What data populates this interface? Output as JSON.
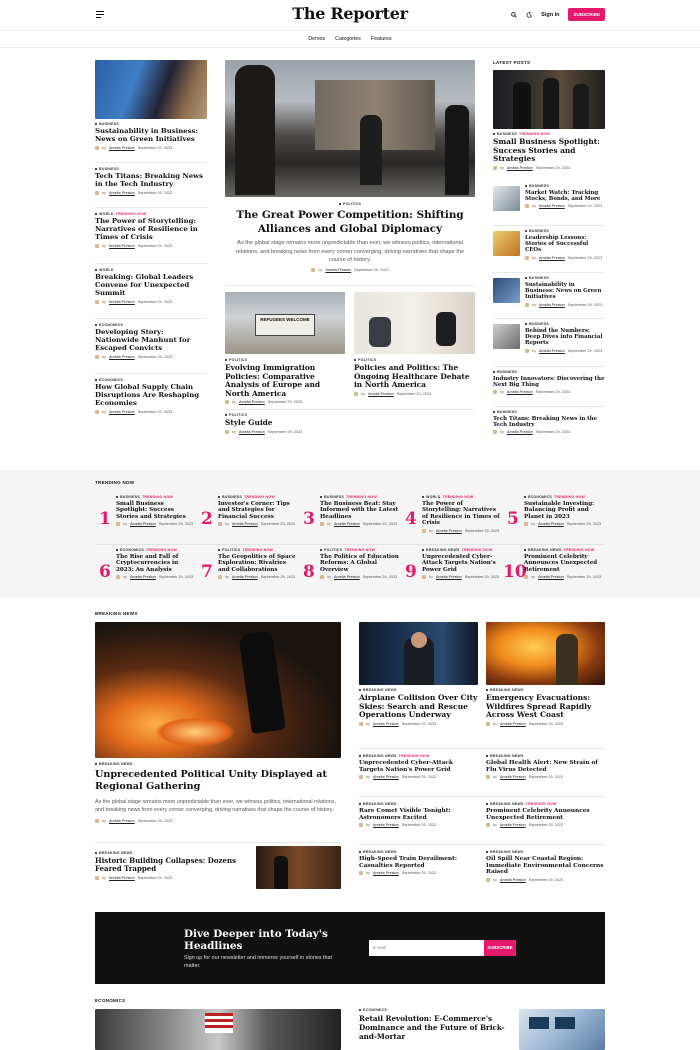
{
  "header": {
    "logo": "The Reporter",
    "sign_in": "Sign in",
    "subscribe": "SUBSCRIBE",
    "nav": [
      "Demos",
      "Categories",
      "Features"
    ]
  },
  "byline": {
    "by": "by",
    "author": "Amelia Preston",
    "date": "September 29, 2023"
  },
  "left_column": [
    {
      "kicker": "BUSINESS",
      "hot": "",
      "title": "Sustainability in Business: News on Green Initiatives"
    },
    {
      "kicker": "BUSINESS",
      "hot": "",
      "title": "Tech Titans: Breaking News in the Tech Industry"
    },
    {
      "kicker": "WORLD",
      "hot": "TRENDING NOW",
      "title": "The Power of Storytelling: Narratives of Resilience in Times of Crisis"
    },
    {
      "kicker": "WORLD",
      "hot": "",
      "title": "Breaking: Global Leaders Convene for Unexpected Summit"
    },
    {
      "kicker": "ECONOMICS",
      "hot": "",
      "title": "Developing Story: Nationwide Manhunt for Escaped Convicts"
    },
    {
      "kicker": "ECONOMICS",
      "hot": "",
      "title": "How Global Supply Chain Disruptions Are Reshaping Economies"
    }
  ],
  "feature": {
    "kicker": "POLITICS",
    "title": "The Great Power Competition: Shifting Alliances and Global Diplomacy",
    "excerpt": "As the global stage remains more unpredictable than ever, we witness politics, international relations, and breaking news from every corner converging, driving narratives that shape the course of history."
  },
  "sub_features": [
    {
      "kicker": "POLITICS",
      "title": "Evolving Immigration Policies: Comparative Analysis of Europe and North America",
      "sign": "REFUGEES WELCOME"
    },
    {
      "kicker": "POLITICS",
      "title": "Policies and Politics: The Ongoing Healthcare Debate in North America"
    }
  ],
  "style_guide": {
    "kicker": "POLITICS",
    "title": "Style Guide"
  },
  "latest": {
    "label": "LATEST POSTS",
    "top": {
      "kicker": "BUSINESS",
      "hot": "TRENDING NOW",
      "title": "Small Business Spotlight: Success Stories and Strategies"
    },
    "items": [
      {
        "kicker": "BUSINESS",
        "title": "Market Watch: Tracking Stocks, Bonds, and More"
      },
      {
        "kicker": "BUSINESS",
        "title": "Leadership Lessons: Stories of Successful CEOs"
      },
      {
        "kicker": "BUSINESS",
        "title": "Sustainability in Business: News on Green Initiatives"
      },
      {
        "kicker": "BUSINESS",
        "title": "Behind the Numbers: Deep Dives into Financial Reports"
      },
      {
        "kicker": "BUSINESS",
        "title": "Industry Innovators: Discovering the Next Big Thing"
      },
      {
        "kicker": "BUSINESS",
        "title": "Tech Titans: Breaking News in the Tech Industry"
      }
    ]
  },
  "trending": {
    "label": "TRENDING NOW",
    "items": [
      {
        "num": "1",
        "kicker": "BUSINESS",
        "title": "Small Business Spotlight: Success Stories and Strategies"
      },
      {
        "num": "2",
        "kicker": "BUSINESS",
        "title": "Investor's Corner: Tips and Strategies for Financial Success"
      },
      {
        "num": "3",
        "kicker": "BUSINESS",
        "title": "The Business Beat: Stay Informed with the Latest Headlines"
      },
      {
        "num": "4",
        "kicker": "WORLD",
        "title": "The Power of Storytelling: Narratives of Resilience in Times of Crisis"
      },
      {
        "num": "5",
        "kicker": "ECONOMICS",
        "title": "Sustainable Investing: Balancing Profit and Planet in 2023"
      },
      {
        "num": "6",
        "kicker": "ECONOMICS",
        "title": "The Rise and Fall of Cryptocurrencies in 2023: An Analysis"
      },
      {
        "num": "7",
        "kicker": "POLITICS",
        "title": "The Geopolitics of Space Exploration: Rivalries and Collaborations"
      },
      {
        "num": "8",
        "kicker": "POLITICS",
        "title": "The Politics of Education Reforms: A Global Overview"
      },
      {
        "num": "9",
        "kicker": "BREAKING NEWS",
        "title": "Unprecedented Cyber-Attack Targets Nation's Power Grid"
      },
      {
        "num": "10",
        "kicker": "BREAKING NEWS",
        "title": "Prominent Celebrity Announces Unexpected Retirement"
      }
    ],
    "hot": "TRENDING NOW"
  },
  "breaking": {
    "label": "BREAKING NEWS",
    "main": {
      "kicker": "BREAKING NEWS",
      "title": "Unprecedented Political Unity Displayed at Regional Gathering",
      "excerpt": "As the global stage remains more unpredictable than ever, we witness politics, international relations, and breaking news from every corner converging, driving narratives that shape the course of history."
    },
    "small": {
      "kicker": "BREAKING NEWS",
      "title": "Historic Building Collapses: Dozens Feared Trapped"
    },
    "grid": [
      {
        "kicker": "BREAKING NEWS",
        "hot": "",
        "title": "Airplane Collision Over City Skies: Search and Rescue Operations Underway"
      },
      {
        "kicker": "BREAKING NEWS",
        "hot": "",
        "title": "Emergency Evacuations: Wildfires Spread Rapidly Across West Coast"
      },
      {
        "kicker": "BREAKING NEWS",
        "hot": "TRENDING NOW",
        "title": "Unprecedented Cyber-Attack Targets Nation's Power Grid"
      },
      {
        "kicker": "BREAKING NEWS",
        "hot": "",
        "title": "Global Health Alert: New Strain of Flu Virus Detected"
      },
      {
        "kicker": "BREAKING NEWS",
        "hot": "",
        "title": "Rare Comet Visible Tonight: Astronomers Excited"
      },
      {
        "kicker": "BREAKING NEWS",
        "hot": "TRENDING NOW",
        "title": "Prominent Celebrity Announces Unexpected Retirement"
      },
      {
        "kicker": "BREAKING NEWS",
        "hot": "",
        "title": "High-Speed Train Derailment: Casualties Reported"
      },
      {
        "kicker": "BREAKING NEWS",
        "hot": "",
        "title": "Oil Spill Near Coastal Region: Immediate Environmental Concerns Raised"
      }
    ]
  },
  "newsletter": {
    "title": "Dive Deeper into Today's Headlines",
    "text": "Sign up for our newsletter and immerse yourself in stories that matter.",
    "placeholder": "E-mail",
    "button": "SUBSCRIBE"
  },
  "economics": {
    "label": "ECONOMICS",
    "article": {
      "kicker": "ECONOMICS",
      "title": "Retail Revolution: E-Commerce's Dominance and the Future of Brick-and-Mortar"
    }
  },
  "colors": {
    "accent": "#e5196b",
    "dark": "#111111",
    "band": "#f5f5f5"
  }
}
